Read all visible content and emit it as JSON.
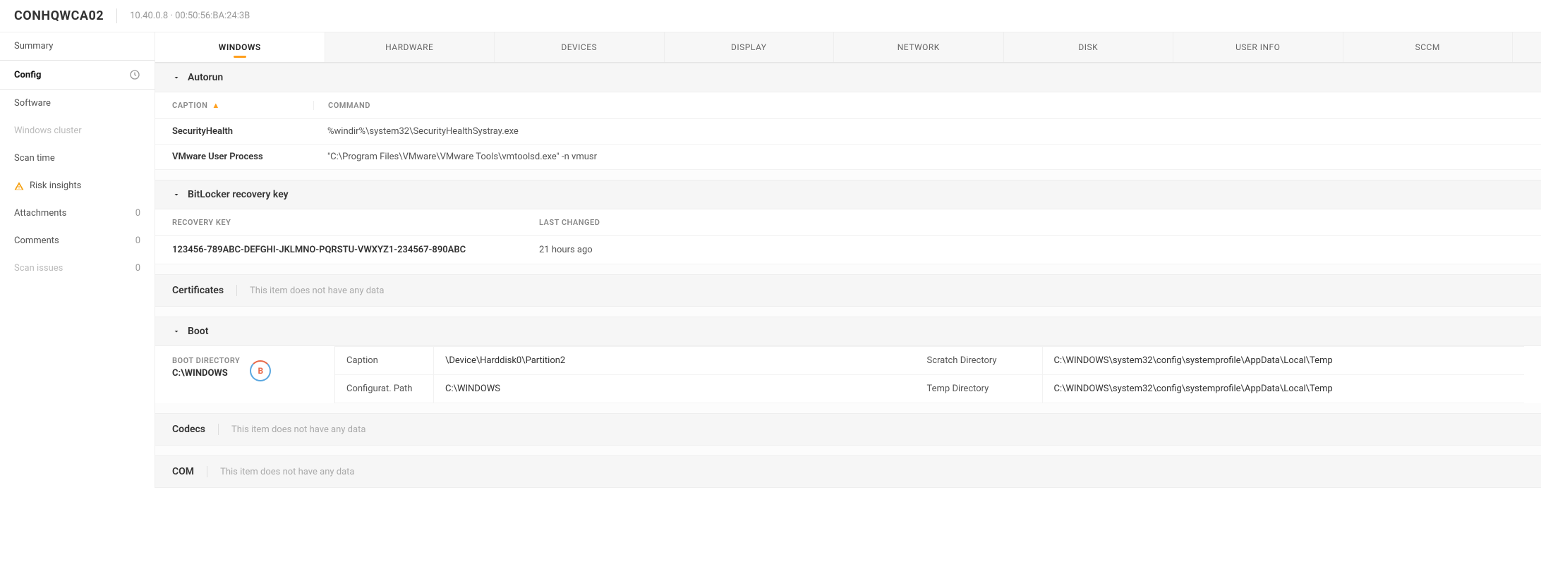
{
  "header": {
    "hostname": "CONHQWCA02",
    "ip": "10.40.0.8",
    "mac": "00:50:56:BA:24:3B"
  },
  "sidebar": {
    "items": [
      {
        "label": "Summary",
        "badge": ""
      },
      {
        "label": "Config",
        "badge": "",
        "active": true,
        "hasRefresh": true
      },
      {
        "label": "Software",
        "badge": ""
      },
      {
        "label": "Windows cluster",
        "badge": "",
        "disabled": true
      },
      {
        "label": "Scan time",
        "badge": ""
      },
      {
        "label": "Risk insights",
        "badge": "",
        "warn": true
      },
      {
        "label": "Attachments",
        "badge": "0"
      },
      {
        "label": "Comments",
        "badge": "0"
      },
      {
        "label": "Scan issues",
        "badge": "0",
        "disabled": true
      }
    ]
  },
  "tabs": [
    "WINDOWS",
    "HARDWARE",
    "DEVICES",
    "DISPLAY",
    "NETWORK",
    "DISK",
    "USER INFO",
    "SCCM"
  ],
  "autorun": {
    "title": "Autorun",
    "headers": {
      "caption": "CAPTION",
      "command": "COMMAND"
    },
    "rows": [
      {
        "caption": "SecurityHealth",
        "command": "%windir%\\system32\\SecurityHealthSystray.exe"
      },
      {
        "caption": "VMware User Process",
        "command": "\"C:\\Program Files\\VMware\\VMware Tools\\vmtoolsd.exe\" -n vmusr"
      }
    ]
  },
  "bitlocker": {
    "title": "BitLocker recovery key",
    "headers": {
      "key": "RECOVERY KEY",
      "changed": "LAST CHANGED"
    },
    "row": {
      "key": "123456-789ABC-DEFGHI-JKLMNO-PQRSTU-VWXYZ1-234567-890ABC",
      "changed": "21 hours ago"
    }
  },
  "certificates": {
    "title": "Certificates",
    "empty": "This item does not have any data"
  },
  "boot": {
    "title": "Boot",
    "left": {
      "label": "BOOT DIRECTORY",
      "value": "C:\\WINDOWS",
      "badge": "B"
    },
    "grid": {
      "caption_label": "Caption",
      "caption_val": "\\Device\\Harddisk0\\Partition2",
      "scratch_label": "Scratch Directory",
      "scratch_val": "C:\\WINDOWS\\system32\\config\\systemprofile\\AppData\\Local\\Temp",
      "conf_label": "Configurat. Path",
      "conf_val": "C:\\WINDOWS",
      "temp_label": "Temp Directory",
      "temp_val": "C:\\WINDOWS\\system32\\config\\systemprofile\\AppData\\Local\\Temp"
    }
  },
  "codecs": {
    "title": "Codecs",
    "empty": "This item does not have any data"
  },
  "com": {
    "title": "COM",
    "empty": "This item does not have any data"
  }
}
